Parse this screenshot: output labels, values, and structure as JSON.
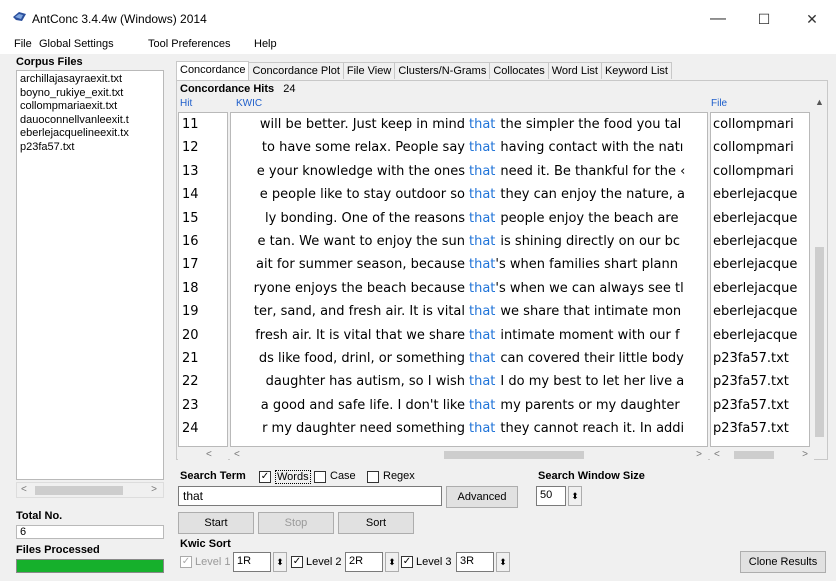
{
  "window": {
    "title": "AntConc 3.4.4w (Windows) 2014",
    "minimize": "—",
    "maximize": "☐",
    "close": "✕"
  },
  "menu": [
    "File",
    "Global Settings",
    "Tool Preferences",
    "Help"
  ],
  "left": {
    "corpus_label": "Corpus Files",
    "files": [
      "archillajasayraexit.txt",
      "boyno_rukiye_exit.txt",
      "collompmariaexit.txt",
      "dauoconnellvanleexit.t",
      "eberlejacquelineexit.tx",
      "p23fa57.txt"
    ],
    "total_label": "Total No.",
    "total_value": "6",
    "processed_label": "Files Processed",
    "progress": 1.0
  },
  "tabs": [
    "Concordance",
    "Concordance Plot",
    "File View",
    "Clusters/N-Grams",
    "Collocates",
    "Word List",
    "Keyword List"
  ],
  "hits": {
    "label": "Concordance Hits",
    "count": "24"
  },
  "columns": {
    "hit": "Hit",
    "kwic": "KWIC",
    "file": "File"
  },
  "rows": [
    {
      "n": "11",
      "left": "will be better. Just keep in mind",
      "key": "that",
      "right": "the simpler the food you tal",
      "file": "collompmari"
    },
    {
      "n": "12",
      "left": "to have some relax. People say",
      "key": "that",
      "right": "having contact with the natı",
      "file": "collompmari"
    },
    {
      "n": "13",
      "left": "e your knowledge with the ones",
      "key": "that",
      "right": "need it. Be thankful for the ‹",
      "file": "collompmari"
    },
    {
      "n": "14",
      "left": "e people like to stay outdoor so",
      "key": "that",
      "right": "they can enjoy the nature, a",
      "file": "eberlejacque"
    },
    {
      "n": "15",
      "left": "ly bonding.  One of the reasons",
      "key": "that",
      "right": "people enjoy the beach are",
      "file": "eberlejacque"
    },
    {
      "n": "16",
      "left": "e tan. We want to enjoy the sun",
      "key": "that",
      "right": "is shining directly on our bc",
      "file": "eberlejacque"
    },
    {
      "n": "17",
      "left": "ait for summer season, because",
      "key": "that",
      "right": "'s when families shart plann",
      "file": "eberlejacque"
    },
    {
      "n": "18",
      "left": "ryone enjoys the beach because",
      "key": "that",
      "right": "'s when we can always see tl",
      "file": "eberlejacque"
    },
    {
      "n": "19",
      "left": "ter, sand, and fresh air. It is vital",
      "key": "that",
      "right": "we share that intimate mon",
      "file": "eberlejacque"
    },
    {
      "n": "20",
      "left": "fresh air. It is vital that we share",
      "key": "that",
      "right": "intimate moment with our f",
      "file": "eberlejacque"
    },
    {
      "n": "21",
      "left": "ds like food, drinl, or something",
      "key": "that",
      "right": "can covered their little body",
      "file": "p23fa57.txt"
    },
    {
      "n": "22",
      "left": "daughter has autism, so I wish",
      "key": "that",
      "right": "I do my best to let her live a",
      "file": "p23fa57.txt"
    },
    {
      "n": "23",
      "left": "a good and safe life. I don't like",
      "key": "that",
      "right": "my parents or my daughter",
      "file": "p23fa57.txt"
    },
    {
      "n": "24",
      "left": "r my daughter need something",
      "key": "that",
      "right": "they cannot reach it. In addi",
      "file": "p23fa57.txt"
    }
  ],
  "search": {
    "label": "Search Term",
    "words_label": "Words",
    "words_checked": true,
    "case_label": "Case",
    "case_checked": false,
    "regex_label": "Regex",
    "regex_checked": false,
    "value": "that",
    "advanced": "Advanced",
    "start": "Start",
    "stop": "Stop",
    "sort": "Sort"
  },
  "window_size": {
    "label": "Search Window Size",
    "value": "50"
  },
  "kwic_sort": {
    "label": "Kwic Sort",
    "level1_label": "Level 1",
    "level1_value": "1R",
    "level1_checked": true,
    "level2_label": "Level 2",
    "level2_value": "2R",
    "level2_checked": true,
    "level3_label": "Level 3",
    "level3_value": "3R",
    "level3_checked": true
  },
  "clone_results": "Clone Results",
  "colors": {
    "keyword": "#1f73d8",
    "header": "#1f5fcb",
    "progress": "#16b02c"
  }
}
